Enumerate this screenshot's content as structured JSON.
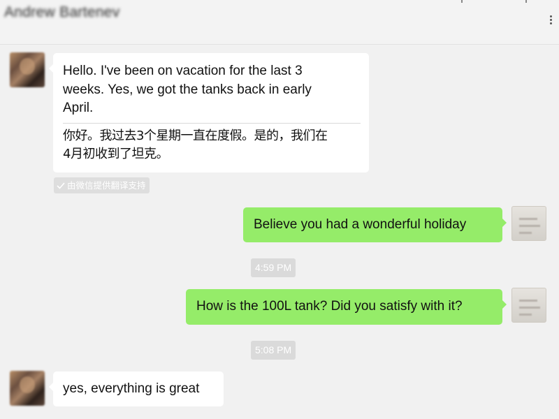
{
  "header": {
    "chat_title": "Andrew Bartenev"
  },
  "messages": {
    "m1": {
      "sender": "contact",
      "text_lines": [
        "Hello. I've been on vacation for the last 3",
        "weeks. Yes, we got the tanks back in early",
        "April."
      ],
      "translation_lines": [
        "你好。我过去3个星期一直在度假。是的，我们在",
        "4月初收到了坦克。"
      ],
      "translation_tag": "由微信提供翻译支持"
    },
    "m2": {
      "sender": "self",
      "text": "Believe you had a wonderful holiday"
    },
    "t1": {
      "text": "4:59 PM"
    },
    "m3": {
      "sender": "self",
      "text": "How is the 100L tank? Did you satisfy with it?"
    },
    "t2": {
      "text": "5:08 PM"
    },
    "m4": {
      "sender": "contact",
      "text": "yes, everything is great"
    }
  },
  "colors": {
    "background": "#f1f1f1",
    "incoming_bubble": "#ffffff",
    "outgoing_bubble": "#95ec69",
    "timestamp_bg": "#dadada"
  },
  "icons": [
    "more-options-icon",
    "translate-check-icon",
    "contact-avatar",
    "self-avatar"
  ]
}
